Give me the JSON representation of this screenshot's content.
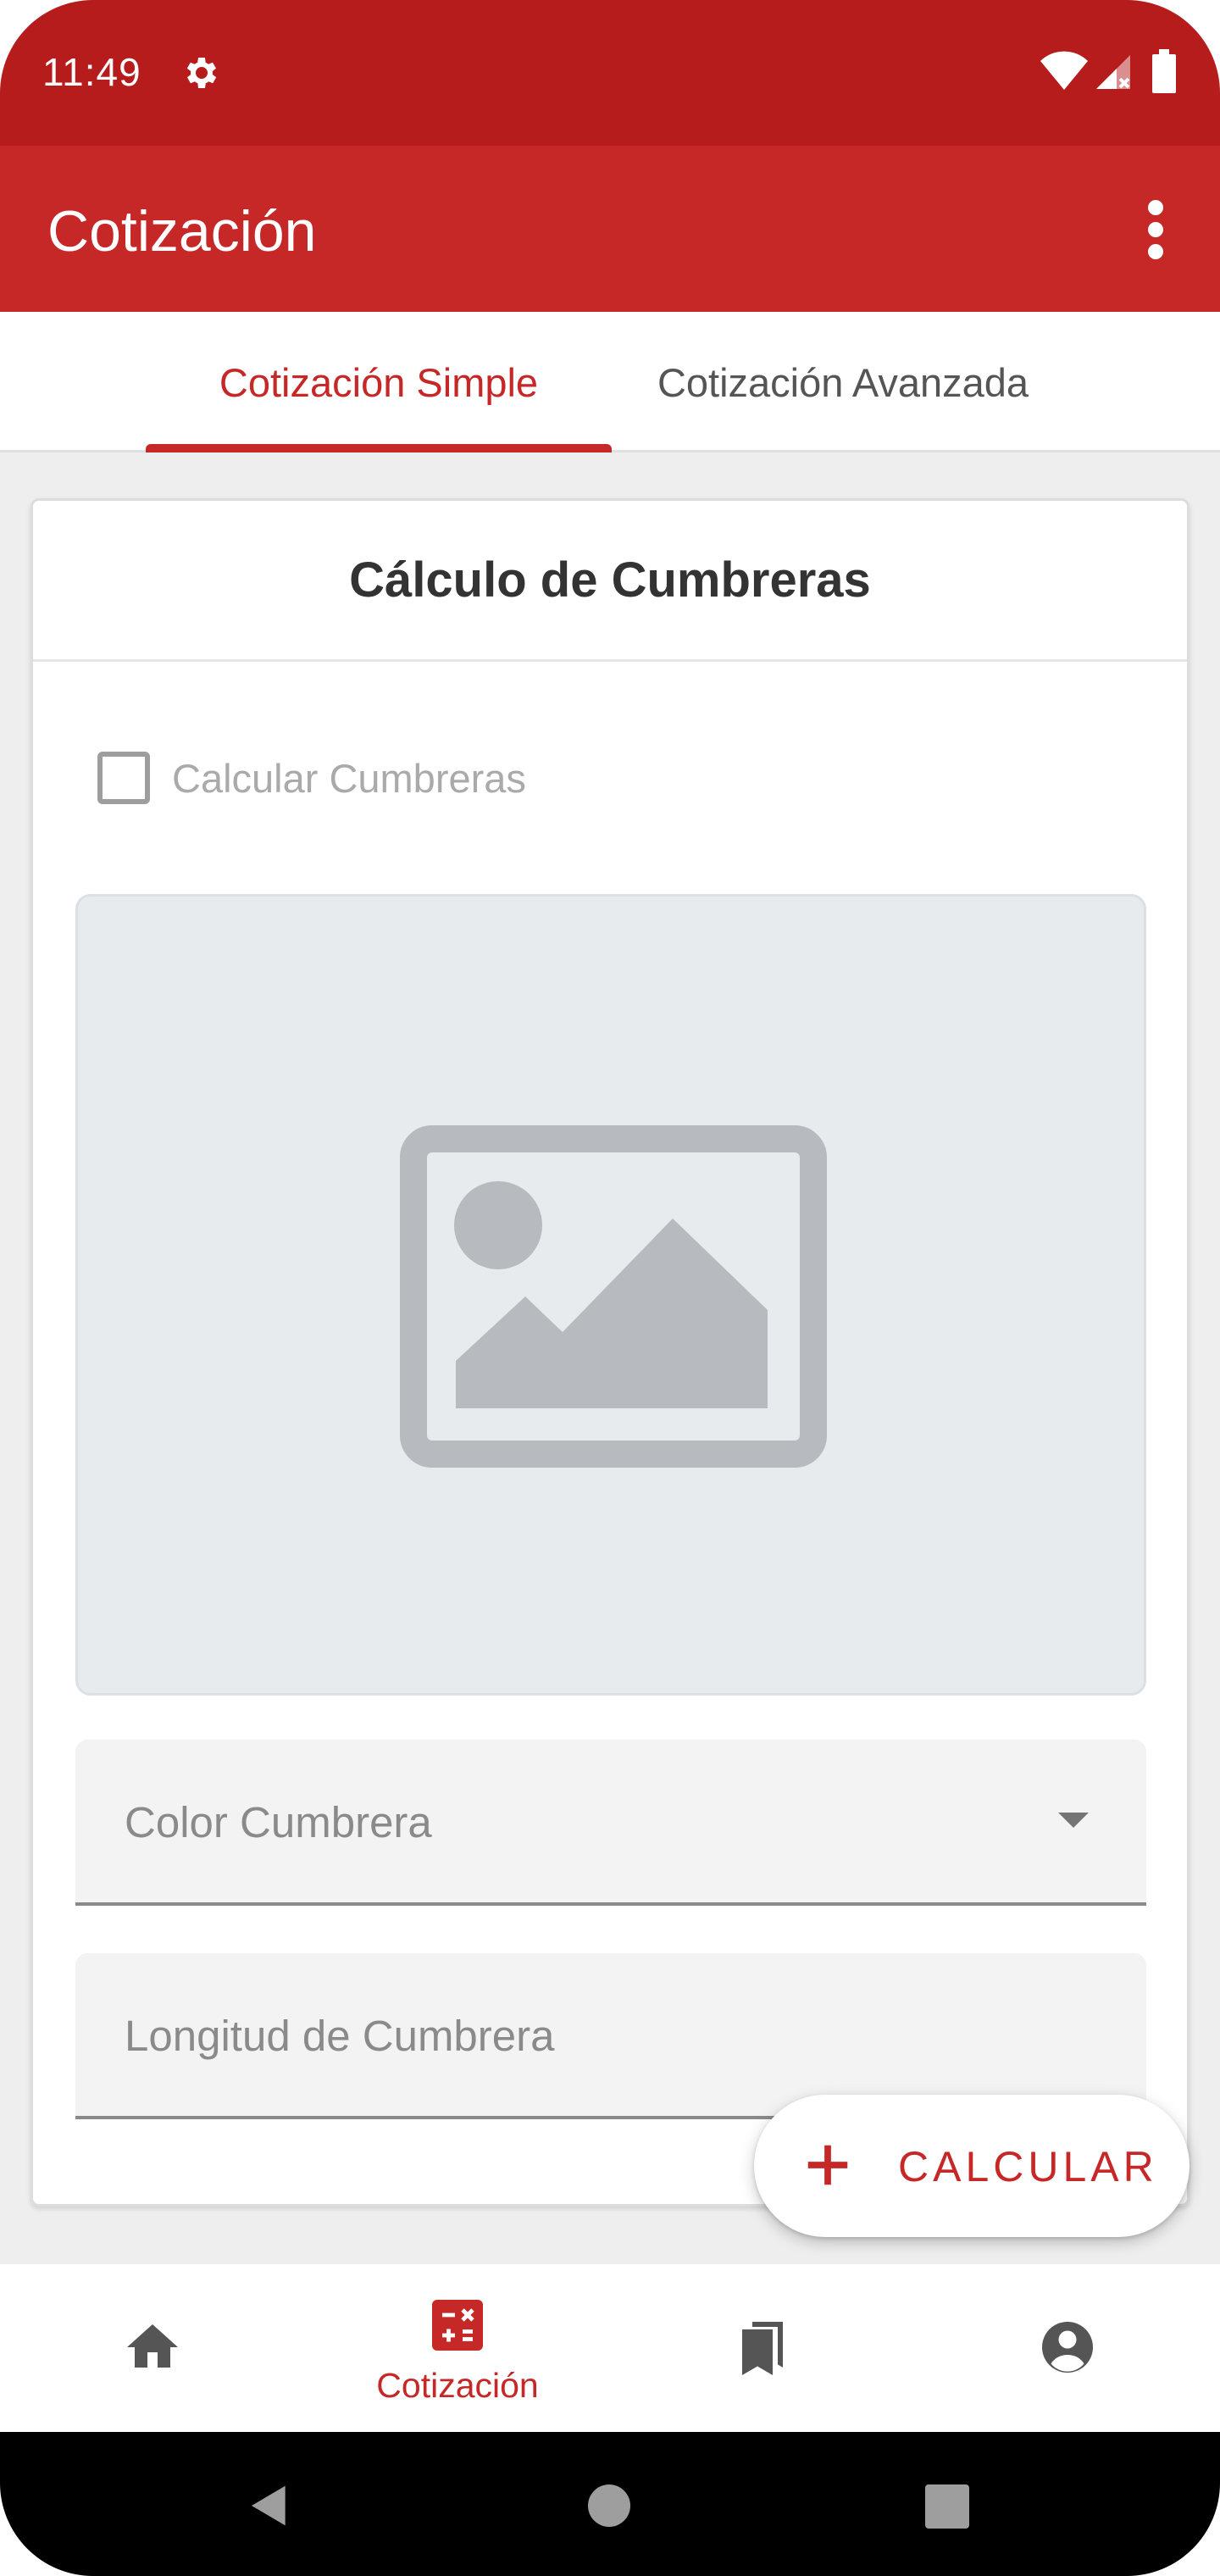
{
  "status_bar": {
    "time": "11:49",
    "icons": [
      "gear-icon",
      "wifi-icon",
      "cell-signal-icon",
      "battery-icon"
    ]
  },
  "app_bar": {
    "title": "Cotización",
    "overflow_icon": "more-vert-icon"
  },
  "tabs": [
    {
      "label": "Cotización Simple",
      "selected": true
    },
    {
      "label": "Cotización Avanzada",
      "selected": false
    }
  ],
  "card": {
    "title": "Cálculo de Cumbreras",
    "checkbox": {
      "label": "Calcular Cumbreras",
      "checked": false
    },
    "image_placeholder_icon": "image-icon",
    "fields": {
      "color": {
        "placeholder": "Color Cumbrera",
        "value": ""
      },
      "length": {
        "placeholder": "Longitud de Cumbrera",
        "value": ""
      }
    }
  },
  "fab": {
    "label": "CALCULAR",
    "icon": "plus-icon"
  },
  "bottom_nav": {
    "items": [
      {
        "icon": "home-icon",
        "label": "",
        "selected": false
      },
      {
        "icon": "calculator-icon",
        "label": "Cotización",
        "selected": true
      },
      {
        "icon": "bookmarks-icon",
        "label": "",
        "selected": false
      },
      {
        "icon": "account-circle-icon",
        "label": "",
        "selected": false
      }
    ]
  },
  "colors": {
    "primary": "#c62828",
    "primary_dark": "#b71c1c",
    "background": "#eeeeee"
  }
}
